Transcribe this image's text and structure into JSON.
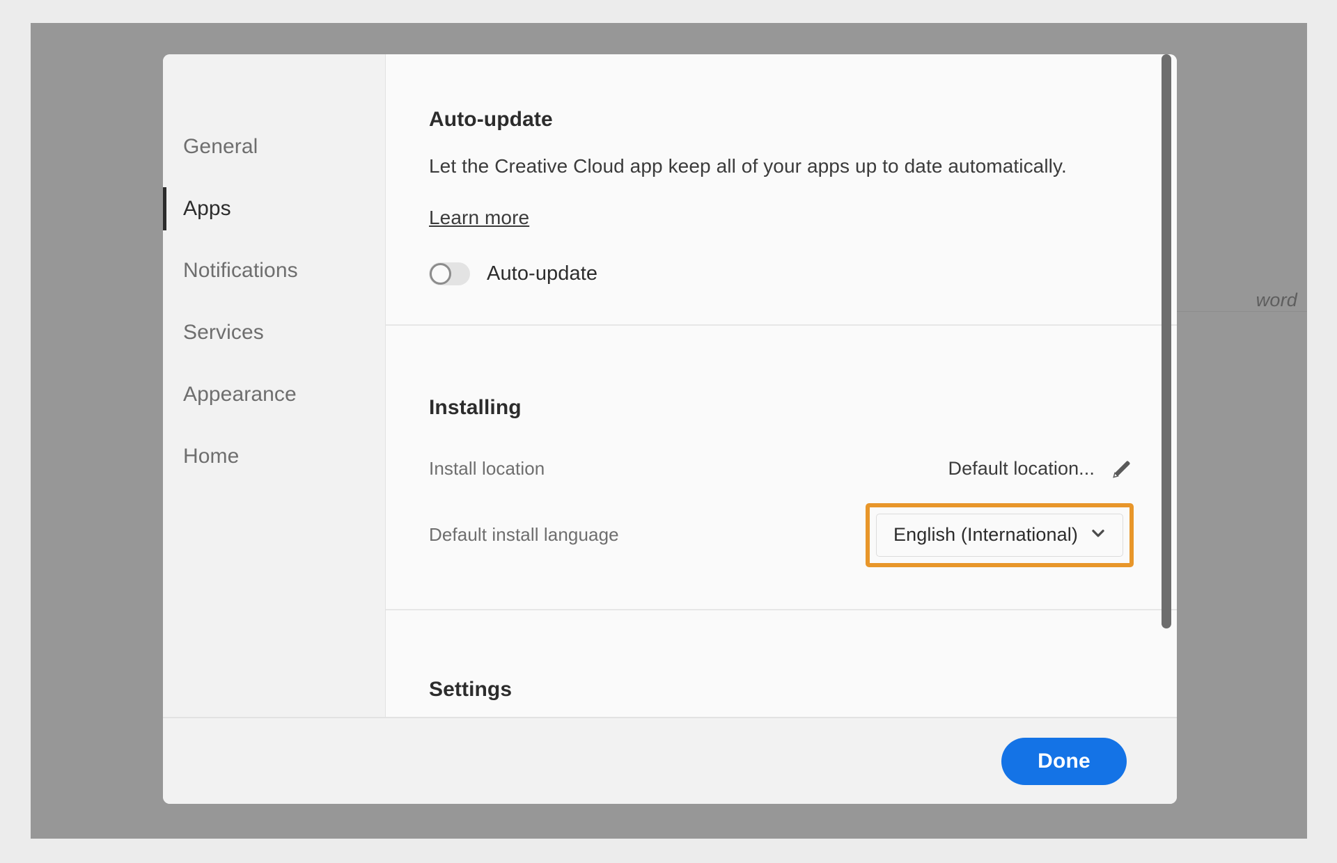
{
  "background": {
    "text_fragment": "word"
  },
  "sidebar": {
    "items": [
      {
        "label": "General",
        "active": false
      },
      {
        "label": "Apps",
        "active": true
      },
      {
        "label": "Notifications",
        "active": false
      },
      {
        "label": "Services",
        "active": false
      },
      {
        "label": "Appearance",
        "active": false
      },
      {
        "label": "Home",
        "active": false
      }
    ]
  },
  "sections": {
    "autoupdate": {
      "title": "Auto-update",
      "description": "Let the Creative Cloud app keep all of your apps up to date automatically.",
      "learn_more": "Learn more",
      "toggle_label": "Auto-update",
      "toggle_state": "off"
    },
    "installing": {
      "title": "Installing",
      "install_location_label": "Install location",
      "install_location_value": "Default location...",
      "edit_icon": "pencil-icon",
      "install_language_label": "Default install language",
      "install_language_value": "English (International)",
      "dropdown_icon": "chevron-down-icon",
      "highlighted": true
    },
    "settings": {
      "title": "Settings"
    }
  },
  "footer": {
    "done_label": "Done"
  },
  "colors": {
    "page_background": "#ECECEC",
    "overlay": "#979797",
    "dialog_background": "#FAFAFA",
    "sidebar_background": "#F2F2F2",
    "accent_blue": "#1473E6",
    "highlight_orange": "#E8962A",
    "active_marker": "#2C2C2C",
    "scrollbar": "#6E6E6E",
    "divider": "#E6E6E6"
  }
}
